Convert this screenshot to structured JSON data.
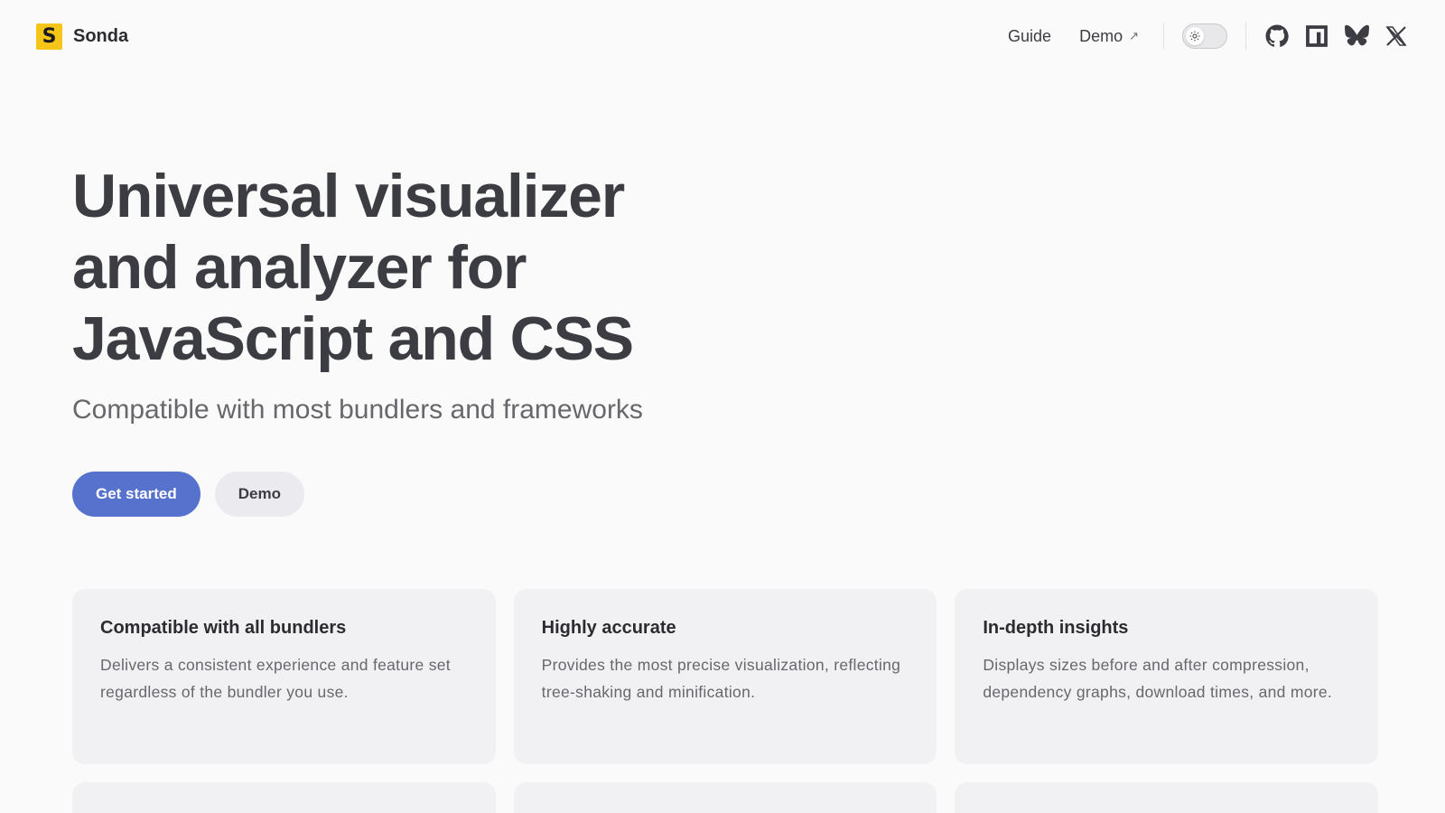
{
  "brand": {
    "name": "Sonda",
    "logo_letter": "S",
    "logo_color": "#f5c518"
  },
  "nav": {
    "links": [
      {
        "label": "Guide",
        "external": false
      },
      {
        "label": "Demo",
        "external": true,
        "external_glyph": "↗"
      }
    ],
    "theme_switch": {
      "icon": "sun-icon",
      "state": "light"
    },
    "socials": [
      {
        "icon": "github-icon"
      },
      {
        "icon": "npm-icon"
      },
      {
        "icon": "bluesky-icon"
      },
      {
        "icon": "x-icon"
      }
    ]
  },
  "hero": {
    "title_lines": [
      "Universal visualizer",
      "and analyzer for",
      "JavaScript and CSS"
    ],
    "tagline": "Compatible with most bundlers and frameworks",
    "actions": {
      "primary": "Get started",
      "secondary": "Demo"
    }
  },
  "features": [
    {
      "title": "Compatible with all bundlers",
      "text": "Delivers a consistent experience and feature set regardless of the bundler you use."
    },
    {
      "title": "Highly accurate",
      "text": "Provides the most precise visualization, reflecting tree-shaking and minification."
    },
    {
      "title": "In-depth insights",
      "text": "Displays sizes before and after compression, dependency graphs, download times, and more."
    }
  ],
  "colors": {
    "accent": "#5672cd",
    "text": "#3c3c43",
    "muted": "#67676c",
    "card_bg": "#f1f1f3"
  }
}
